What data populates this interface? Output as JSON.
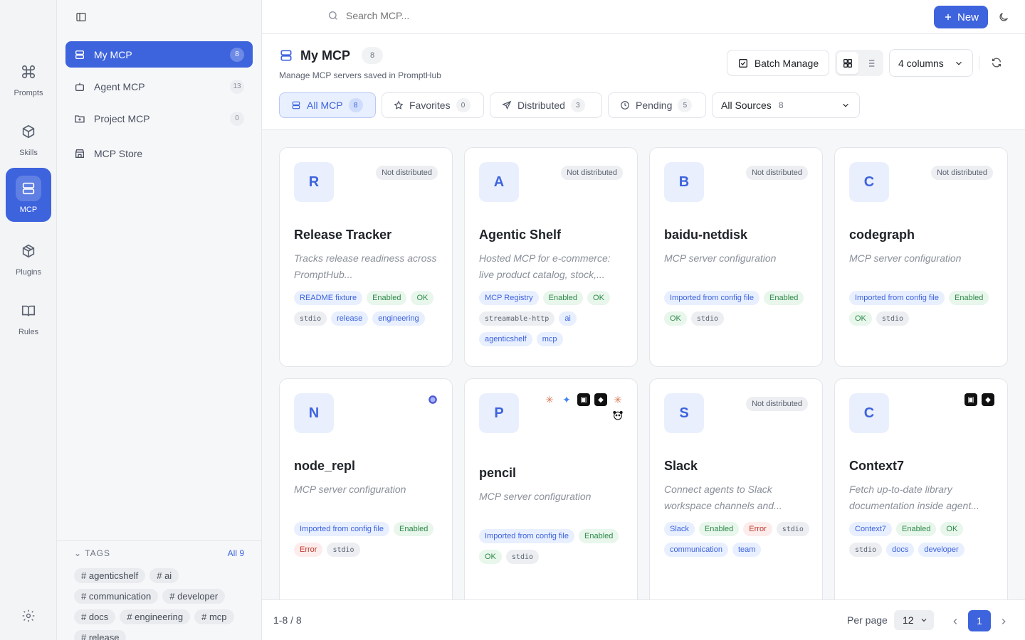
{
  "rail": {
    "items": [
      {
        "label": "Prompts",
        "icon": "command-icon"
      },
      {
        "label": "Skills",
        "icon": "cube-icon"
      },
      {
        "label": "MCP",
        "icon": "server-icon",
        "active": true
      },
      {
        "label": "Plugins",
        "icon": "package-icon"
      },
      {
        "label": "Rules",
        "icon": "book-icon"
      }
    ]
  },
  "sidebar": {
    "items": [
      {
        "label": "My MCP",
        "count": "8",
        "active": true
      },
      {
        "label": "Agent MCP",
        "count": "13"
      },
      {
        "label": "Project MCP",
        "count": "0"
      },
      {
        "label": "MCP Store",
        "count": ""
      }
    ],
    "tags": {
      "heading": "TAGS",
      "all_label": "All 9",
      "items": [
        "# agenticshelf",
        "# ai",
        "# communication",
        "# developer",
        "# docs",
        "# engineering",
        "# mcp",
        "# release"
      ]
    }
  },
  "topbar": {
    "search_placeholder": "Search MCP...",
    "new_label": "New"
  },
  "header": {
    "title": "My MCP",
    "count": "8",
    "subtitle": "Manage MCP servers saved in PromptHub",
    "batch_label": "Batch Manage",
    "columns_label": "4 columns",
    "filters": [
      {
        "label": "All MCP",
        "count": "8"
      },
      {
        "label": "Favorites",
        "count": "0"
      },
      {
        "label": "Distributed",
        "count": "3"
      },
      {
        "label": "Pending",
        "count": "5"
      }
    ],
    "source": {
      "label": "All Sources",
      "count": "8"
    }
  },
  "cards": [
    {
      "letter": "R",
      "name": "Release Tracker",
      "status": "Not distributed",
      "desc": "Tracks release readiness across PromptHub...",
      "chips": [
        [
          "README fixture",
          "blue"
        ],
        [
          "Enabled",
          "green"
        ],
        [
          "OK",
          "green"
        ],
        [
          "stdio",
          "gray"
        ],
        [
          "release",
          "blue"
        ],
        [
          "engineering",
          "blue"
        ]
      ]
    },
    {
      "letter": "A",
      "name": "Agentic Shelf",
      "status": "Not distributed",
      "desc": "Hosted MCP for e-commerce: live product catalog, stock,...",
      "chips": [
        [
          "MCP Registry",
          "blue"
        ],
        [
          "Enabled",
          "green"
        ],
        [
          "OK",
          "green"
        ],
        [
          "streamable-http",
          "gray"
        ],
        [
          "ai",
          "blue"
        ],
        [
          "agenticshelf",
          "blue"
        ],
        [
          "mcp",
          "blue"
        ]
      ]
    },
    {
      "letter": "B",
      "name": "baidu-netdisk",
      "status": "Not distributed",
      "desc": "MCP server configuration",
      "chips": [
        [
          "Imported from config file",
          "blue"
        ],
        [
          "Enabled",
          "green"
        ],
        [
          "OK",
          "green"
        ],
        [
          "stdio",
          "gray"
        ]
      ]
    },
    {
      "letter": "C",
      "name": "codegraph",
      "status": "Not distributed",
      "desc": "MCP server configuration",
      "chips": [
        [
          "Imported from config file",
          "blue"
        ],
        [
          "Enabled",
          "green"
        ],
        [
          "OK",
          "green"
        ],
        [
          "stdio",
          "gray"
        ]
      ]
    },
    {
      "letter": "N",
      "name": "node_repl",
      "status": "",
      "desc": "MCP server configuration",
      "chips": [
        [
          "Imported from config file",
          "blue"
        ],
        [
          "Enabled",
          "green"
        ],
        [
          "Error",
          "red"
        ],
        [
          "stdio",
          "gray"
        ]
      ]
    },
    {
      "letter": "P",
      "name": "pencil",
      "status": "",
      "desc": "MCP server configuration",
      "chips": [
        [
          "Imported from config file",
          "blue"
        ],
        [
          "Enabled",
          "green"
        ],
        [
          "OK",
          "green"
        ],
        [
          "stdio",
          "gray"
        ]
      ]
    },
    {
      "letter": "S",
      "name": "Slack",
      "status": "Not distributed",
      "desc": "Connect agents to Slack workspace channels and...",
      "chips": [
        [
          "Slack",
          "blue"
        ],
        [
          "Enabled",
          "green"
        ],
        [
          "Error",
          "red"
        ],
        [
          "stdio",
          "gray"
        ],
        [
          "communication",
          "blue"
        ],
        [
          "team",
          "blue"
        ]
      ]
    },
    {
      "letter": "C",
      "name": "Context7",
      "status": "",
      "desc": "Fetch up-to-date library documentation inside agent...",
      "chips": [
        [
          "Context7",
          "blue"
        ],
        [
          "Enabled",
          "green"
        ],
        [
          "OK",
          "green"
        ],
        [
          "stdio",
          "gray"
        ],
        [
          "docs",
          "blue"
        ],
        [
          "developer",
          "blue"
        ]
      ]
    }
  ],
  "footer": {
    "range": "1-8 / 8",
    "per_page_label": "Per page",
    "per_page_value": "12",
    "page": "1"
  },
  "colors": {
    "accent": "#3d63dd",
    "ok": "#2f8a4a",
    "error": "#c0392b"
  }
}
